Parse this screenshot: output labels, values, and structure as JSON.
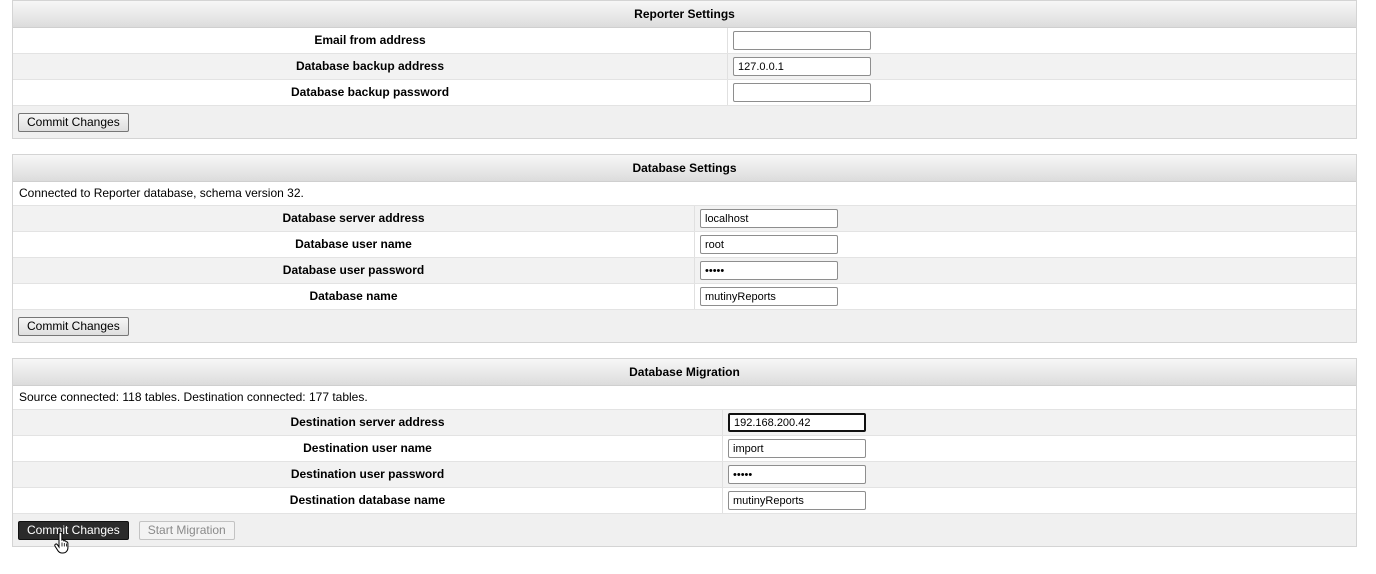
{
  "reporter": {
    "title": "Reporter Settings",
    "fields": [
      {
        "label": "Email from address",
        "value": ""
      },
      {
        "label": "Database backup address",
        "value": "127.0.0.1"
      },
      {
        "label": "Database backup password",
        "value": ""
      }
    ],
    "commit_label": "Commit Changes"
  },
  "database": {
    "title": "Database Settings",
    "status": "Connected to Reporter database, schema version 32.",
    "fields": [
      {
        "label": "Database server address",
        "value": "localhost"
      },
      {
        "label": "Database user name",
        "value": "root"
      },
      {
        "label": "Database user password",
        "value": "•••••"
      },
      {
        "label": "Database name",
        "value": "mutinyReports"
      }
    ],
    "commit_label": "Commit Changes"
  },
  "migration": {
    "title": "Database Migration",
    "status": "Source connected: 118 tables. Destination connected: 177 tables.",
    "fields": [
      {
        "label": "Destination server address",
        "value": "192.168.200.42"
      },
      {
        "label": "Destination user name",
        "value": "import"
      },
      {
        "label": "Destination user password",
        "value": "•••••"
      },
      {
        "label": "Destination database name",
        "value": "mutinyReports"
      }
    ],
    "commit_label": "Commit Changes",
    "start_label": "Start Migration"
  }
}
